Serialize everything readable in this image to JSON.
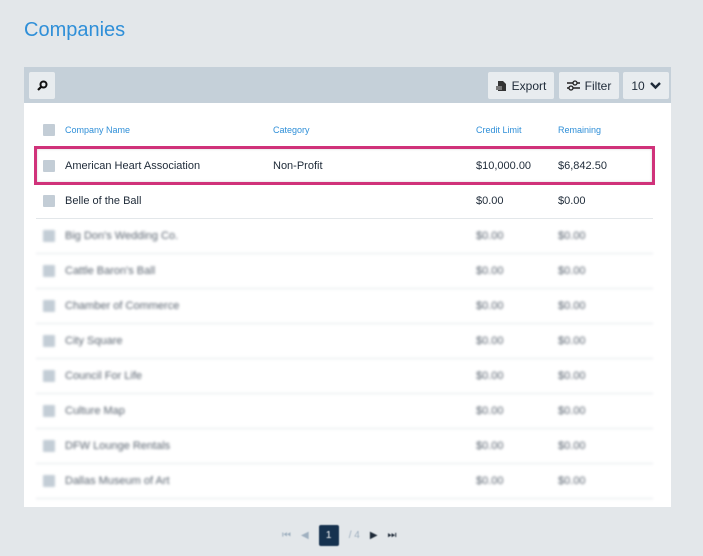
{
  "page": {
    "title": "Companies"
  },
  "toolbar": {
    "search_icon": "search-icon",
    "export_label": "Export",
    "filter_label": "Filter",
    "page_size": "10"
  },
  "table": {
    "headers": [
      "Company Name",
      "Category",
      "Credit Limit",
      "Remaining"
    ],
    "rows": [
      {
        "name": "American Heart Association",
        "category": "Non-Profit",
        "credit": "$10,000.00",
        "remaining": "$6,842.50"
      },
      {
        "name": "Belle of the Ball",
        "category": "",
        "credit": "$0.00",
        "remaining": "$0.00"
      },
      {
        "name": "Big Don's Wedding Co.",
        "category": "",
        "credit": "$0.00",
        "remaining": "$0.00"
      },
      {
        "name": "Cattle Baron's Ball",
        "category": "",
        "credit": "$0.00",
        "remaining": "$0.00"
      },
      {
        "name": "Chamber of Commerce",
        "category": "",
        "credit": "$0.00",
        "remaining": "$0.00"
      },
      {
        "name": "City Square",
        "category": "",
        "credit": "$0.00",
        "remaining": "$0.00"
      },
      {
        "name": "Council For Life",
        "category": "",
        "credit": "$0.00",
        "remaining": "$0.00"
      },
      {
        "name": "Culture Map",
        "category": "",
        "credit": "$0.00",
        "remaining": "$0.00"
      },
      {
        "name": "DFW Lounge Rentals",
        "category": "",
        "credit": "$0.00",
        "remaining": "$0.00"
      },
      {
        "name": "Dallas Museum of Art",
        "category": "",
        "credit": "$0.00",
        "remaining": "$0.00"
      }
    ]
  },
  "pagination": {
    "current": "1",
    "total": "/ 4"
  },
  "colors": {
    "accent": "#2f8fd8",
    "highlight": "#d0327a",
    "active_page": "#16324f"
  }
}
